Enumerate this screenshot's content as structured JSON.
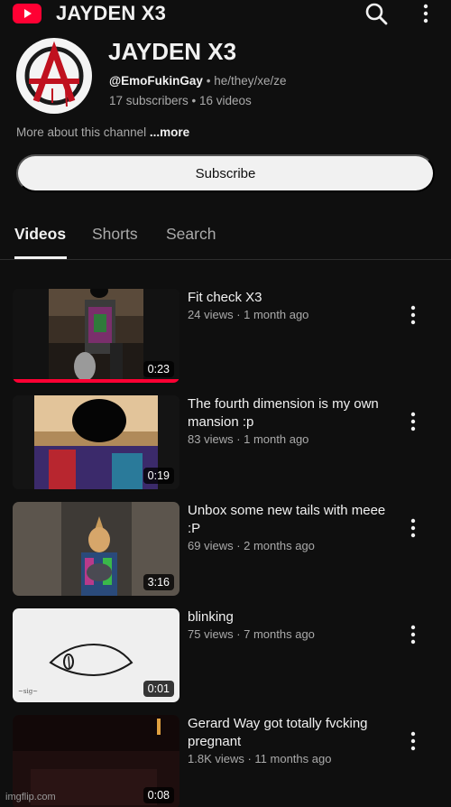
{
  "header": {
    "logo_icon": "youtube-logo-icon",
    "title": "JAYDEN X3",
    "search_icon": "search-icon",
    "menu_icon": "more-vert-icon"
  },
  "channel": {
    "name": "JAYDEN X3",
    "handle": "@EmoFukinGay",
    "separator": "•",
    "pronouns": "he/they/xe/ze",
    "stats": "17 subscribers • 16 videos",
    "about_prefix": "More about this channel",
    "about_more": "...more",
    "subscribe_label": "Subscribe"
  },
  "tabs": [
    {
      "label": "Videos",
      "active": true
    },
    {
      "label": "Shorts",
      "active": false
    },
    {
      "label": "Search",
      "active": false
    }
  ],
  "videos": [
    {
      "title": "Fit check X3",
      "meta": "24 views · 1 month ago",
      "duration": "0:23",
      "watched_fraction": 1.0
    },
    {
      "title": "The fourth dimension is my own mansion :p",
      "meta": "83 views · 1 month ago",
      "duration": "0:19"
    },
    {
      "title": "Unbox some new tails with meee :P",
      "meta": "69 views · 2 months ago",
      "duration": "3:16"
    },
    {
      "title": "blinking",
      "meta": "75 views · 7 months ago",
      "duration": "0:01"
    },
    {
      "title": "Gerard Way got totally fvcking pregnant",
      "meta": "1.8K views · 11 months ago",
      "duration": "0:08"
    }
  ],
  "watermark": "imgflip.com",
  "colors": {
    "background": "#0f0f0f",
    "accent": "#ff0033",
    "text": "#f1f1f1",
    "muted": "#aaaaaa"
  }
}
